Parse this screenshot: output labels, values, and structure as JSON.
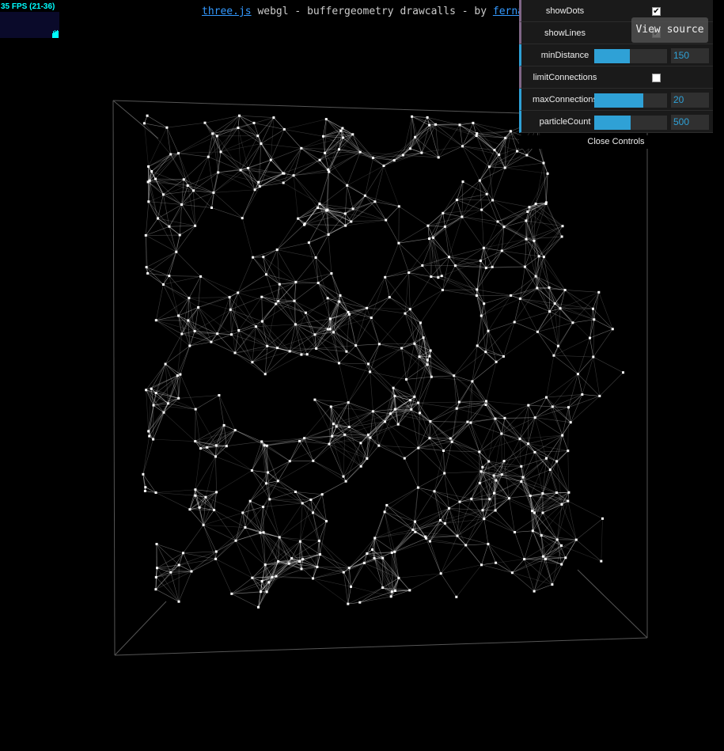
{
  "stats": {
    "fps_text": "35 FPS (21-36)",
    "color": "#00ffff"
  },
  "info": {
    "link1": "three.js",
    "text": " webgl - buffergeometry drawcalls - by ",
    "link2": "fernandoj"
  },
  "gui": {
    "controls": [
      {
        "label": "showDots",
        "type": "boolean",
        "checked": true
      },
      {
        "label": "showLines",
        "type": "boolean",
        "checked": true
      },
      {
        "label": "minDistance",
        "type": "number",
        "value": "150",
        "fill": 0.49
      },
      {
        "label": "limitConnections",
        "type": "boolean",
        "checked": false
      },
      {
        "label": "maxConnections",
        "type": "number",
        "value": "20",
        "fill": 0.67
      },
      {
        "label": "particleCount",
        "type": "number",
        "value": "500",
        "fill": 0.5
      }
    ],
    "close_label": "Close Controls",
    "accent": "#2fa1d6"
  },
  "view_source": "View source",
  "scene": {
    "particle_color": "#ffffff",
    "line_color": "#ffffff",
    "background": "#000000"
  }
}
